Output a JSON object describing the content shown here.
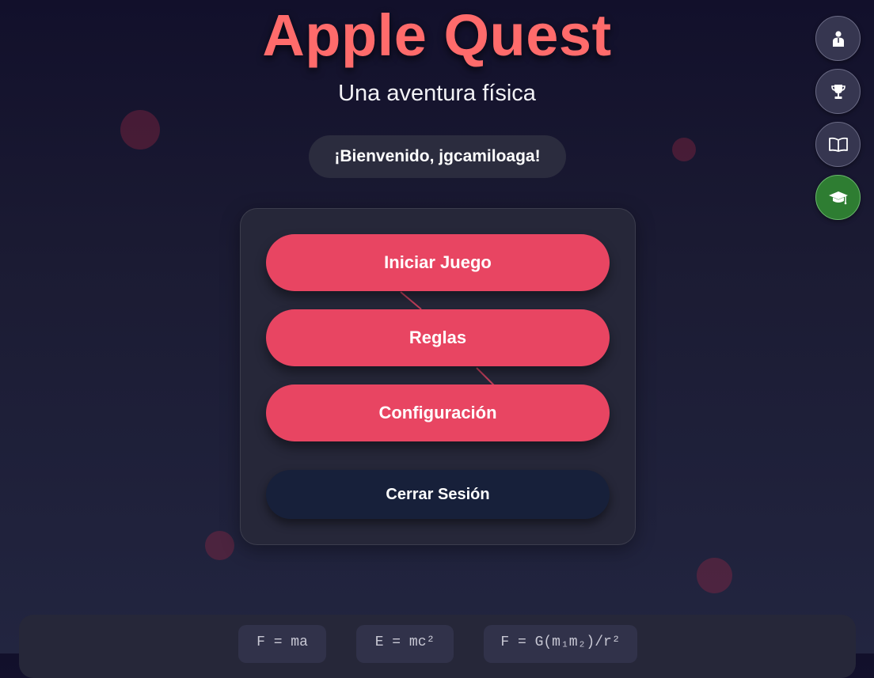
{
  "title": "Apple Quest",
  "subtitle": "Una aventura física",
  "welcome": "¡Bienvenido, jgcamiloaga!",
  "menu": {
    "start": "Iniciar Juego",
    "rules": "Reglas",
    "settings": "Configuración",
    "logout": "Cerrar Sesión"
  },
  "side_buttons": [
    {
      "icon": "profile-icon",
      "active": false
    },
    {
      "icon": "trophy-icon",
      "active": false
    },
    {
      "icon": "book-icon",
      "active": false
    },
    {
      "icon": "graduation-cap-icon",
      "active": true
    }
  ],
  "formulas": [
    "F = ma",
    "E = mc²",
    "F = G(m₁m₂)/r²"
  ],
  "colors": {
    "title": "#ff6b6b",
    "primary_button": "#e84562",
    "logout_button": "#17203a",
    "active_side_button": "#2e7d32"
  }
}
